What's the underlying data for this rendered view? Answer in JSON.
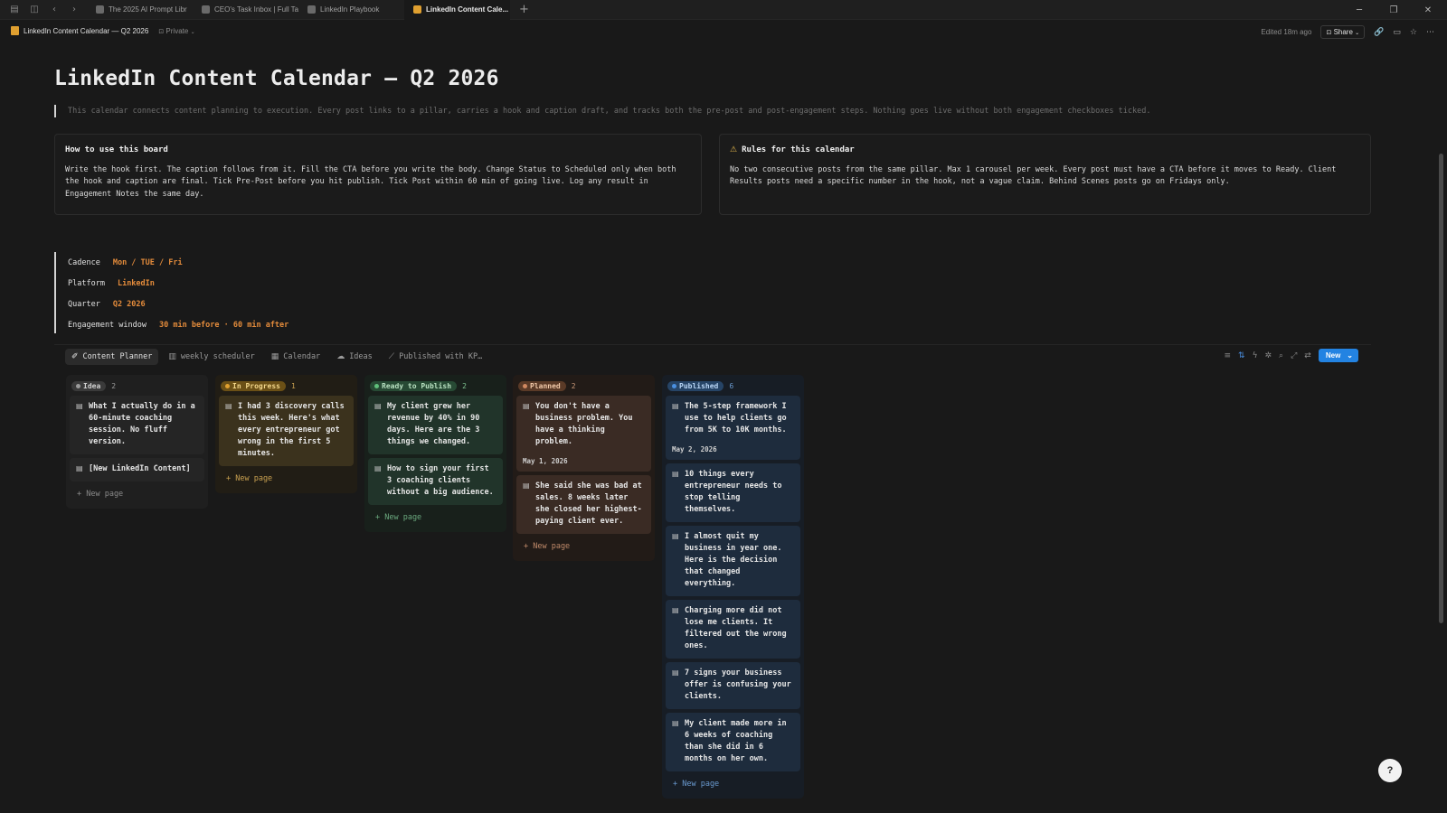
{
  "browser": {
    "tabs": [
      {
        "label": "The 2025 AI Prompt Libr",
        "active": false
      },
      {
        "label": "CEO's Task Inbox | Full Task I",
        "active": false
      },
      {
        "label": "LinkedIn Playbook",
        "active": false
      },
      {
        "label": "LinkedIn Content Cale...",
        "active": true
      }
    ],
    "new_tab": "+"
  },
  "topbar": {
    "page_name": "LinkedIn Content Calendar — Q2 2026",
    "privacy": "Private",
    "edited": "Edited 18m ago",
    "share": "Share"
  },
  "page": {
    "title": "LinkedIn Content Calendar — Q2 2026",
    "quote": "This calendar connects content planning to execution. Every post links to a pillar, carries a hook and caption draft, and tracks both the pre-post and post-engagement steps. Nothing goes live without both engagement checkboxes ticked.",
    "callout_left": {
      "title": "How to use this board",
      "body": "Write the hook first. The caption follows from it. Fill the CTA before you write the body. Change Status to Scheduled only when both the hook and caption are final. Tick Pre-Post before you hit publish. Tick Post within 60 min of going live. Log any result in Engagement Notes the same day."
    },
    "callout_right": {
      "title": "Rules for this calendar",
      "body": "No two consecutive posts from the same pillar. Max 1 carousel per week. Every post must have a CTA before it moves to Ready. Client Results posts need a specific number in the hook, not a vague claim. Behind Scenes posts go on Fridays only."
    },
    "meta": [
      {
        "label": "Cadence",
        "value": "Mon / TUE / Fri"
      },
      {
        "label": "Platform",
        "value": "LinkedIn"
      },
      {
        "label": "Quarter",
        "value": "Q2 2026"
      },
      {
        "label": "Engagement window",
        "value": "30 min before · 60 min after"
      }
    ]
  },
  "board": {
    "views": [
      {
        "label": "Content Planner",
        "icon": "✐"
      },
      {
        "label": "weekly scheduler",
        "icon": "▥"
      },
      {
        "label": "Calendar",
        "icon": "▦"
      },
      {
        "label": "Ideas",
        "icon": "☁"
      },
      {
        "label": "Published with KP…",
        "icon": "⟋"
      }
    ],
    "new_label": "New",
    "new_page": "+ New page",
    "columns": [
      {
        "status": "Idea",
        "count": "2",
        "pill_bg": "#3a3a3a",
        "pill_fg": "#d0d0d0",
        "dot": "#9b9b9b",
        "col_bg": "#1f1f1f",
        "card_bg": "#252525",
        "count_fg": "#9a9a9a",
        "new_fg": "#8a8a8a",
        "cards": [
          {
            "title": "What I actually do in a 60-minute coaching session. No fluff version.",
            "date": ""
          },
          {
            "title": "[New LinkedIn Content]",
            "date": ""
          }
        ]
      },
      {
        "status": "In Progress",
        "count": "1",
        "pill_bg": "#6b5016",
        "pill_fg": "#f2d68a",
        "dot": "#e0a030",
        "col_bg": "#211d15",
        "card_bg": "#3b321d",
        "count_fg": "#c8a050",
        "new_fg": "#c8a050",
        "cards": [
          {
            "title": "I had 3 discovery calls this week. Here's what every entrepreneur got wrong in the first 5 minutes.",
            "date": ""
          }
        ]
      },
      {
        "status": "Ready to Publish",
        "count": "2",
        "pill_bg": "#274a34",
        "pill_fg": "#b8e0c0",
        "dot": "#5fbf7a",
        "col_bg": "#18201b",
        "card_bg": "#21342a",
        "count_fg": "#7cbf8e",
        "new_fg": "#6aa87e",
        "cards": [
          {
            "title": "My client grew her revenue by 40% in 90 days. Here are the 3 things we changed.",
            "date": ""
          },
          {
            "title": "How to sign your first 3 coaching clients without a big audience.",
            "date": ""
          }
        ]
      },
      {
        "status": "Planned",
        "count": "2",
        "pill_bg": "#5a3a27",
        "pill_fg": "#f0c8a8",
        "dot": "#d08860",
        "col_bg": "#221b17",
        "card_bg": "#3a2b24",
        "count_fg": "#c89878",
        "new_fg": "#c08a6a",
        "cards": [
          {
            "title": "You don't have a business problem. You have a thinking problem.",
            "date": "May 1, 2026"
          },
          {
            "title": "She said she was bad at sales. 8 weeks later she closed her highest-paying client ever.",
            "date": ""
          }
        ]
      },
      {
        "status": "Published",
        "count": "6",
        "pill_bg": "#264466",
        "pill_fg": "#b8d4f4",
        "dot": "#4a8fe0",
        "col_bg": "#171d25",
        "card_bg": "#1e2c3d",
        "count_fg": "#6a9ad0",
        "new_fg": "#6a9ad0",
        "cards": [
          {
            "title": "The 5-step framework I use to help clients go from 5K to 10K months.",
            "date": "May 2, 2026"
          },
          {
            "title": "10 things every entrepreneur needs to stop telling themselves.",
            "date": ""
          },
          {
            "title": "I almost quit my business in year one. Here is the decision that changed everything.",
            "date": ""
          },
          {
            "title": "Charging more did not lose me clients. It filtered out the wrong ones.",
            "date": ""
          },
          {
            "title": "7 signs your business offer is confusing your clients.",
            "date": ""
          },
          {
            "title": "My client made more in 6 weeks of coaching than she did in 6 months on her own.",
            "date": ""
          }
        ]
      }
    ]
  }
}
